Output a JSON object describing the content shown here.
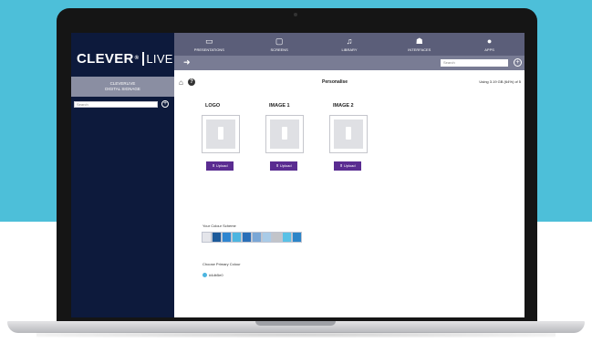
{
  "brand": {
    "name": "CLEVER",
    "reg": "®",
    "suffix": "LIVE"
  },
  "organization": {
    "line1": "CLEVERLIVE",
    "line2": "DIGITAL SIGNAGE"
  },
  "sidebar": {
    "search_placeholder": "Search"
  },
  "nav": {
    "items": [
      {
        "label": "PRESENTATIONS",
        "icon": "presentation-icon"
      },
      {
        "label": "SCREENS",
        "icon": "monitor-icon"
      },
      {
        "label": "LIBRARY",
        "icon": "library-icon"
      },
      {
        "label": "INTERFACES",
        "icon": "users-icon"
      },
      {
        "label": "APPS",
        "icon": "apps-icon"
      }
    ]
  },
  "subbar": {
    "search_placeholder": "Search"
  },
  "page": {
    "title": "Personalise",
    "storage": "Using 3.19 GB (64%) of 5"
  },
  "images": [
    {
      "title": "LOGO",
      "button": "Upload"
    },
    {
      "title": "IMAGE 1",
      "button": "Upload"
    },
    {
      "title": "IMAGE 2",
      "button": "Upload"
    }
  ],
  "colour_scheme": {
    "label": "Your Colour Scheme",
    "swatches": [
      "#e4e5ea",
      "#1c5a9a",
      "#2f86d0",
      "#4db5e0",
      "#2a6fb8",
      "#7aa7d6",
      "#a9cbe7",
      "#c2c4c9",
      "#59c1e6",
      "#2c85c8"
    ]
  },
  "primary_colour": {
    "label": "Choose Primary Colour",
    "option": "#4db5e0"
  },
  "colors": {
    "background_top": "#4dbfd9",
    "sidebar": "#0d1a3c",
    "nav": "#5b5e79",
    "button": "#5a2c91"
  }
}
